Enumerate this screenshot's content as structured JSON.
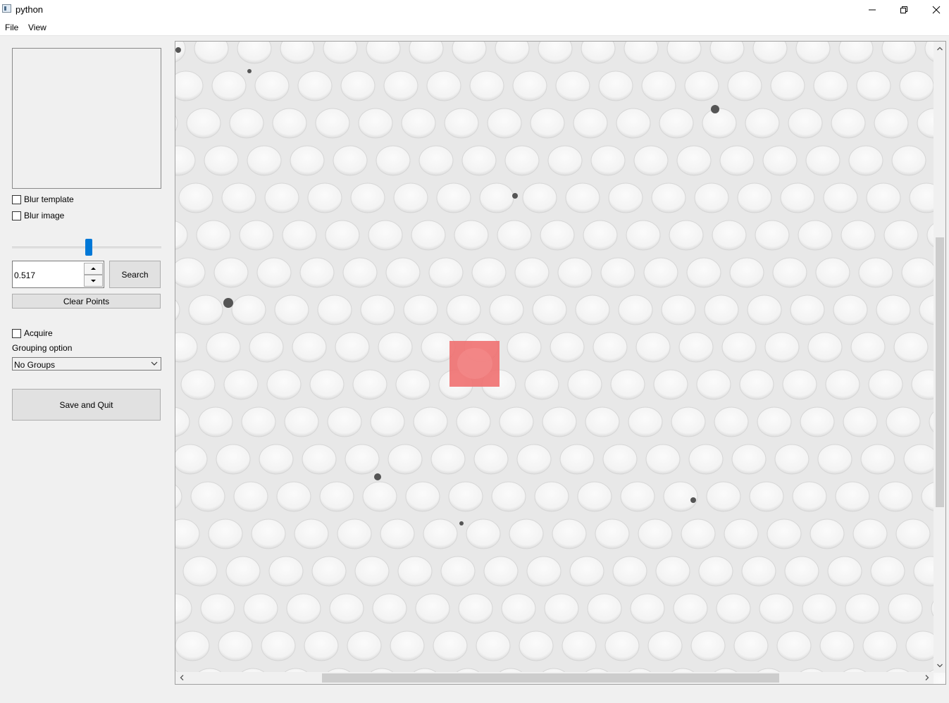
{
  "window": {
    "title": "python"
  },
  "menu": {
    "items": [
      "File",
      "View"
    ]
  },
  "controls": {
    "blur_template_label": "Blur template",
    "blur_template_checked": false,
    "blur_image_label": "Blur image",
    "blur_image_checked": false,
    "threshold_slider_fraction": 0.517,
    "threshold_value": "0.517",
    "search_label": "Search",
    "clear_points_label": "Clear Points",
    "acquire_label": "Acquire",
    "acquire_checked": false,
    "grouping_label": "Grouping option",
    "grouping_value": "No Groups",
    "save_quit_label": "Save and Quit"
  },
  "colors": {
    "slider_thumb": "#0078d7",
    "selection_marker": "#f07070",
    "specimen_background": "#e8e8e8",
    "hole": "#f7f7f7"
  },
  "icons": [
    "app-icon",
    "minimize-icon",
    "restore-icon",
    "close-icon",
    "chevron-down-icon",
    "spin-up-icon",
    "spin-down-icon",
    "scroll-up-icon",
    "scroll-down-icon",
    "scroll-left-icon",
    "scroll-right-icon"
  ]
}
